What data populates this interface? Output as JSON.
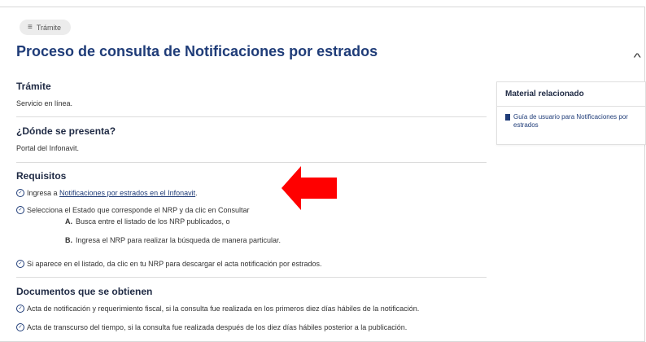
{
  "badge": {
    "label": "Trámite"
  },
  "page_title": "Proceso de consulta de Notificaciones por estrados",
  "sections": {
    "tramite": {
      "heading": "Trámite",
      "text": "Servicio en línea."
    },
    "donde": {
      "heading": "¿Dónde se presenta?",
      "text": "Portal del Infonavit."
    },
    "requisitos": {
      "heading": "Requisitos",
      "step1_prefix": "Ingresa a ",
      "step1_link": "Notificaciones por estrados en el Infonavit",
      "step1_suffix": ".",
      "step2": "Selecciona el Estado que corresponde el NRP y da clic en Consultar",
      "step2_a_letter": "A.",
      "step2_a": "Busca entre el listado de los NRP publicados, o",
      "step2_b_letter": "B.",
      "step2_b": "Ingresa el NRP para realizar la búsqueda de manera particular.",
      "step3": "Si aparece en el listado, da clic en tu NRP para descargar el acta notificación por estrados."
    },
    "documentos": {
      "heading": "Documentos que se obtienen",
      "item1": "Acta de notificación y requerimiento fiscal, si la consulta fue realizada en los primeros diez días hábiles de la notificación.",
      "item2": "Acta de transcurso del tiempo, si la consulta fue realizada después de los diez días hábiles posterior a la publicación."
    }
  },
  "sidebar_card": {
    "heading": "Material relacionado",
    "link": "Guía de usuario para Notificaciones por estrados"
  },
  "icons": {
    "badge": "document-icon",
    "collapse": "chevron-up-icon",
    "check": "check-circle-icon",
    "file": "file-icon",
    "annotation": "arrow-left-icon"
  },
  "colors": {
    "title": "#1f3c78",
    "arrow": "#ff0000"
  }
}
